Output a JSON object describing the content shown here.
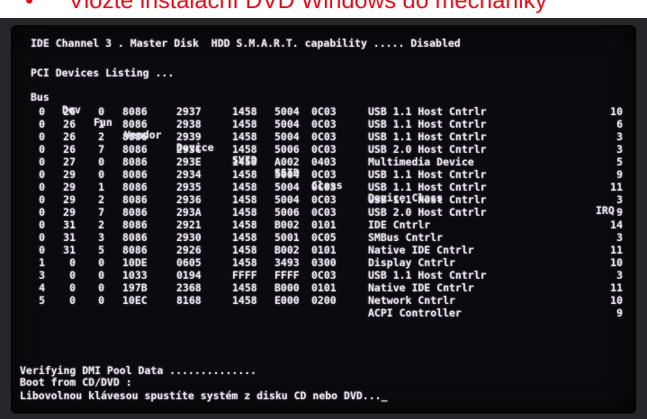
{
  "caption": {
    "bullet": "•",
    "text": "Vložte instalační DVD Windows do mechaniky"
  },
  "bios": {
    "ide_line": "IDE Channel 3 . Master Disk  HDD S.M.A.R.T. capability ..... Disabled",
    "pci_title": "PCI Devices Listing ...",
    "columns": [
      "Bus",
      "Dev",
      "Fun",
      "Vendor",
      "Device",
      "SVID",
      "SSID",
      "Class",
      "Device Class",
      "IRQ"
    ],
    "rows": [
      [
        "0",
        "26",
        "0",
        "8086",
        "2937",
        "1458",
        "5004",
        "0C03",
        "USB 1.1 Host Cntrlr",
        "10"
      ],
      [
        "0",
        "26",
        "1",
        "8086",
        "2938",
        "1458",
        "5004",
        "0C03",
        "USB 1.1 Host Cntrlr",
        "6"
      ],
      [
        "0",
        "26",
        "2",
        "8086",
        "2939",
        "1458",
        "5004",
        "0C03",
        "USB 1.1 Host Cntrlr",
        "3"
      ],
      [
        "0",
        "26",
        "7",
        "8086",
        "293C",
        "1458",
        "5006",
        "0C03",
        "USB 2.0 Host Cntrlr",
        "3"
      ],
      [
        "0",
        "27",
        "0",
        "8086",
        "293E",
        "1458",
        "A002",
        "0403",
        "Multimedia Device",
        "5"
      ],
      [
        "0",
        "29",
        "0",
        "8086",
        "2934",
        "1458",
        "5004",
        "0C03",
        "USB 1.1 Host Cntrlr",
        "9"
      ],
      [
        "0",
        "29",
        "1",
        "8086",
        "2935",
        "1458",
        "5004",
        "0C03",
        "USB 1.1 Host Cntrlr",
        "11"
      ],
      [
        "0",
        "29",
        "2",
        "8086",
        "2936",
        "1458",
        "5004",
        "0C03",
        "USB 1.1 Host Cntrlr",
        "3"
      ],
      [
        "0",
        "29",
        "7",
        "8086",
        "293A",
        "1458",
        "5006",
        "0C03",
        "USB 2.0 Host Cntrlr",
        "9"
      ],
      [
        "0",
        "31",
        "2",
        "8086",
        "2921",
        "1458",
        "B002",
        "0101",
        "IDE Cntrlr",
        "14"
      ],
      [
        "0",
        "31",
        "3",
        "8086",
        "2930",
        "1458",
        "5001",
        "0C05",
        "SMBus Cntrlr",
        "3"
      ],
      [
        "0",
        "31",
        "5",
        "8086",
        "2926",
        "1458",
        "B002",
        "0101",
        "Native IDE Cntrlr",
        "11"
      ],
      [
        "1",
        "0",
        "0",
        "10DE",
        "0605",
        "1458",
        "3493",
        "0300",
        "Display Cntrlr",
        "10"
      ],
      [
        "3",
        "0",
        "0",
        "1033",
        "0194",
        "FFFF",
        "FFFF",
        "0C03",
        "USB 1.1 Host Cntrlr",
        "3"
      ],
      [
        "4",
        "0",
        "0",
        "197B",
        "2368",
        "1458",
        "B000",
        "0101",
        "Native IDE Cntrlr",
        "11"
      ],
      [
        "5",
        "0",
        "0",
        "10EC",
        "8168",
        "1458",
        "E000",
        "0200",
        "Network Cntrlr",
        "10"
      ],
      [
        "",
        "",
        "",
        "",
        "",
        "",
        "",
        "",
        "ACPI Controller",
        "9"
      ]
    ],
    "dmi_line": "Verifying DMI Pool Data ..............",
    "boot_line": "Boot from CD/DVD :",
    "prompt_line": "Libovolnou klávesou spustíte systém z disku CD nebo DVD.",
    "cursor": ".._",
    "colors": {
      "text": "#e9e6ee",
      "screen": "#0b0a0e",
      "caption": "#e0101a"
    }
  }
}
